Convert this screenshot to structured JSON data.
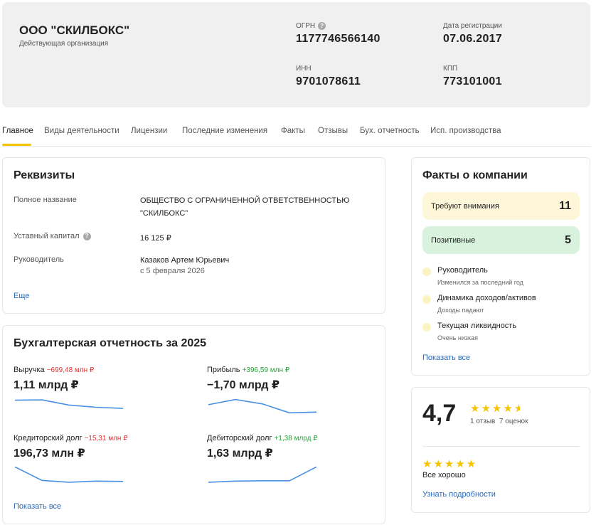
{
  "header": {
    "company_name": "ООО \"СКИЛБОКС\"",
    "status": "Действующая организация",
    "ogrn_label": "ОГРН",
    "ogrn_value": "1177746566140",
    "reg_date_label": "Дата регистрации",
    "reg_date_value": "07.06.2017",
    "inn_label": "ИНН",
    "inn_value": "9701078611",
    "kpp_label": "КПП",
    "kpp_value": "773101001"
  },
  "tabs": [
    {
      "label": "Главное",
      "active": true
    },
    {
      "label": "Виды деятельности"
    },
    {
      "label": "Лицензии"
    },
    {
      "label": "Последние изменения"
    },
    {
      "label": "Факты"
    },
    {
      "label": "Отзывы"
    },
    {
      "label": "Бух. отчетность"
    },
    {
      "label": "Исп. производства"
    }
  ],
  "requisites": {
    "title": "Реквизиты",
    "full_name_label": "Полное название",
    "full_name_line1": "ОБЩЕСТВО С ОГРАНИЧЕННОЙ ОТВЕТСТВЕННОСТЬЮ",
    "full_name_line2": "\"СКИЛБОКС\"",
    "capital_label": "Уставный капитал",
    "capital_value": "16 125 ₽",
    "head_label": "Руководитель",
    "head_value": "Казаков Артем Юрьевич",
    "head_since": "с 5 февраля 2026",
    "more_link": "Еще"
  },
  "finance": {
    "title": "Бухгалтерская отчетность за 2025",
    "metrics": [
      {
        "label": "Выручка",
        "delta": "−699,48 млн ₽",
        "delta_sign": "neg",
        "value": "1,11 млрд ₽",
        "trend": [
          0.86,
          0.88,
          0.6,
          0.48,
          0.42
        ]
      },
      {
        "label": "Прибыль",
        "delta": "+396,59 млн ₽",
        "delta_sign": "pos",
        "value": "−1,70 млрд ₽",
        "trend": [
          0.62,
          0.9,
          0.66,
          0.18,
          0.22
        ]
      },
      {
        "label": "Кредиторский долг",
        "delta": "−15,31 млн ₽",
        "delta_sign": "neg",
        "value": "196,73 млн ₽",
        "trend": [
          0.95,
          0.22,
          0.12,
          0.18,
          0.16
        ]
      },
      {
        "label": "Дебиторский долг",
        "delta": "+1,38 млрд ₽",
        "delta_sign": "pos",
        "value": "1,63 млрд ₽",
        "trend": [
          0.12,
          0.18,
          0.2,
          0.2,
          0.95
        ]
      }
    ],
    "show_all": "Показать все"
  },
  "facts": {
    "title": "Факты о компании",
    "attention_label": "Требуют внимания",
    "attention_count": "11",
    "positive_label": "Позитивные",
    "positive_count": "5",
    "items": [
      {
        "title": "Руководитель",
        "sub": "Изменился за последний год"
      },
      {
        "title": "Динамика доходов/активов",
        "sub": "Доходы падают"
      },
      {
        "title": "Текущая ликвидность",
        "sub": "Очень низкая"
      }
    ],
    "show_all": "Показать все"
  },
  "rating": {
    "score": "4,7",
    "stars_value": 4.7,
    "reviews": "1 отзыв",
    "ratings": "7 оценок",
    "review_stars": 5,
    "review_text": "Все хорошо",
    "details_link": "Узнать подробности"
  },
  "colors": {
    "accent": "#f5c400",
    "attention_bg": "#fdf6d8",
    "positive_bg": "#d8f2de",
    "link": "#2a6ab8",
    "negative": "#e03030",
    "positive": "#2aa33a",
    "sparkline": "#4a90e2"
  }
}
